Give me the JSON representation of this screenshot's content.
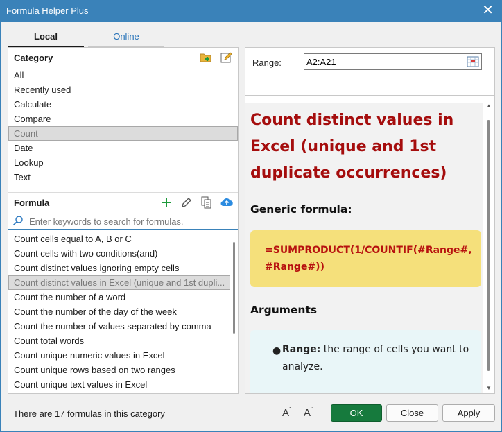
{
  "window": {
    "title": "Formula Helper Plus",
    "close_glyph": "✕"
  },
  "tabs": [
    {
      "label": "Local"
    },
    {
      "label": "Online"
    }
  ],
  "category": {
    "header": "Category",
    "items": [
      {
        "label": "All"
      },
      {
        "label": "Recently used"
      },
      {
        "label": "Calculate"
      },
      {
        "label": "Compare"
      },
      {
        "label": "Count",
        "selected": true
      },
      {
        "label": "Date"
      },
      {
        "label": "Lookup"
      },
      {
        "label": "Text"
      }
    ]
  },
  "formula": {
    "header": "Formula",
    "search_placeholder": "Enter keywords to search for formulas.",
    "items": [
      {
        "label": "Count cells equal to A, B or C"
      },
      {
        "label": "Count cells with two conditions(and)"
      },
      {
        "label": "Count distinct values ignoring empty cells"
      },
      {
        "label": "Count distinct values in Excel (unique and 1st dupli...",
        "selected": true
      },
      {
        "label": "Count the number of a word"
      },
      {
        "label": "Count the number of the day of the week"
      },
      {
        "label": "Count the number of values separated by comma"
      },
      {
        "label": "Count total words"
      },
      {
        "label": "Count unique numeric values in Excel"
      },
      {
        "label": "Count unique rows based on two ranges"
      },
      {
        "label": "Count unique text values in Excel"
      }
    ]
  },
  "range": {
    "label": "Range:",
    "value": "A2:A21"
  },
  "content": {
    "title": "Count distinct values in Excel (unique and 1st duplicate occurrences)",
    "generic_heading": "Generic formula:",
    "formula_line1": "=SUMPRODUCT(1/COUNTIF(#Range#,",
    "formula_line2": "#Range#))",
    "arguments_heading": "Arguments",
    "arg_name": "Range:",
    "arg_desc": " the range of cells you want to analyze."
  },
  "status": {
    "text": "There are 17 formulas in this category"
  },
  "buttons": {
    "ok": "OK",
    "close": "Close",
    "apply": "Apply"
  },
  "colors": {
    "title_bar": "#3a82b9",
    "heading_red": "#a50d0d",
    "code_bg": "#f5e07b",
    "ok_green": "#167a3d",
    "link_blue": "#2672b8"
  }
}
